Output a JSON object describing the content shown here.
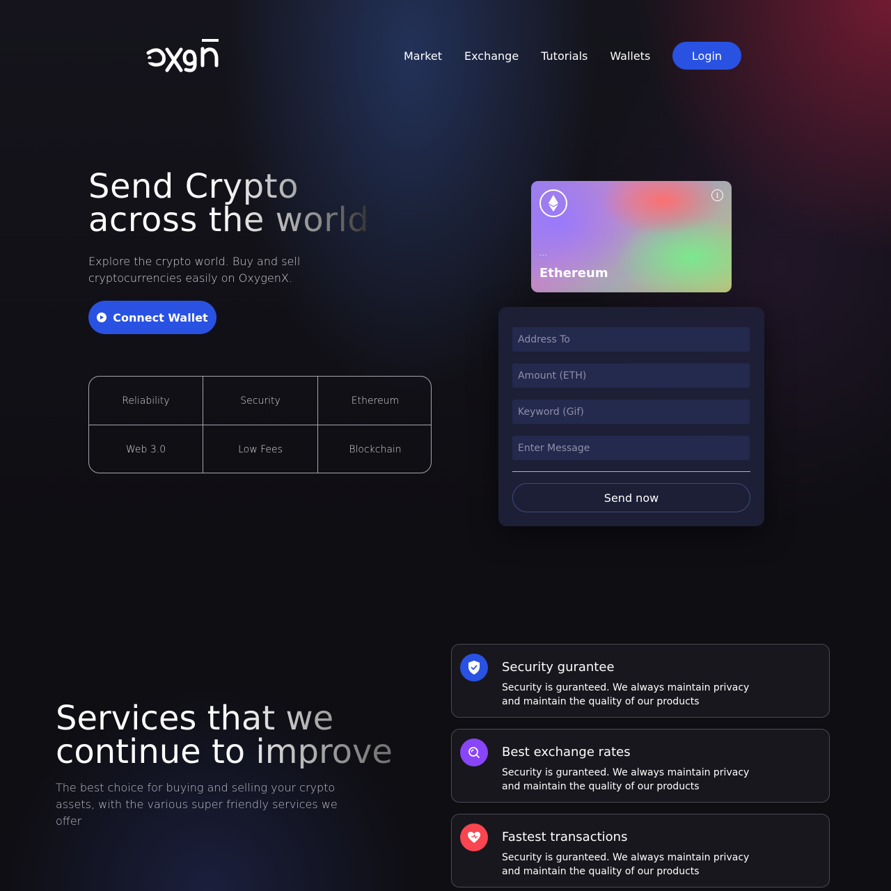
{
  "brand": {
    "logo_text": "oxgn"
  },
  "nav": {
    "items": [
      "Market",
      "Exchange",
      "Tutorials",
      "Wallets"
    ],
    "login_label": "Login"
  },
  "hero": {
    "title_line1": "Send Crypto",
    "title_line2": "across the world",
    "subtitle": "Explore the crypto world. Buy and sell cryptocurrencies easily on OxygenX.",
    "connect_label": "Connect Wallet",
    "features": [
      "Reliability",
      "Security",
      "Ethereum",
      "Web 3.0",
      "Low Fees",
      "Blockchain"
    ]
  },
  "card": {
    "address": "...",
    "name": "Ethereum",
    "info_glyph": "i"
  },
  "form": {
    "address_placeholder": "Address To",
    "amount_placeholder": "Amount (ETH)",
    "keyword_placeholder": "Keyword (Gif)",
    "message_placeholder": "Enter Message",
    "send_label": "Send now"
  },
  "services": {
    "title_line1": "Services that we",
    "title_line2": "continue to improve",
    "subtitle": "The best choice for buying and selling your crypto assets, with the various super friendly services we offer",
    "items": [
      {
        "title": "Security gurantee",
        "desc": "Security is guranteed. We always maintain privacy and maintain the quality of our products",
        "icon": "shield-check-icon",
        "color": "#2952e3"
      },
      {
        "title": "Best exchange rates",
        "desc": "Security is guranteed. We always maintain privacy and maintain the quality of our products",
        "icon": "search-icon",
        "color": "#8945f8"
      },
      {
        "title": "Fastest transactions",
        "desc": "Security is guranteed. We always maintain privacy and maintain the quality of our products",
        "icon": "heart-icon",
        "color": "#f84550"
      }
    ]
  },
  "colors": {
    "accent": "#2952e3",
    "background": "#0f0e13"
  }
}
